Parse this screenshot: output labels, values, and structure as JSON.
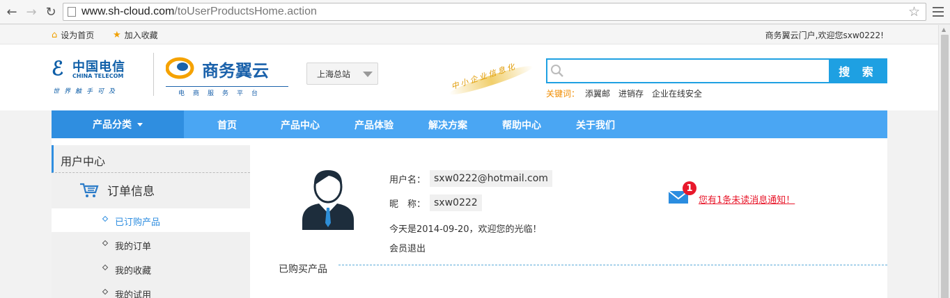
{
  "browser": {
    "url_host": "www.sh-cloud.com",
    "url_path": "/toUserProductsHome.action"
  },
  "topbar": {
    "set_home": "设为首页",
    "add_favorite": "加入收藏",
    "welcome": "商务翼云门户,欢迎您sxw0222!"
  },
  "header": {
    "ct_logo_cn": "中国电信",
    "ct_logo_en": "CHINA TELECOM",
    "ct_slogan": "世界触手可及",
    "sw_logo_cn": "商务翼云",
    "sw_logo_sub": "电商服务平台",
    "station": "上海总站",
    "tagline": "中小企业信息化",
    "search_button": "搜 索",
    "search_placeholder": "",
    "keywords_label": "关键词：",
    "keywords": [
      "添翼邮",
      "进销存",
      "企业在线安全"
    ]
  },
  "nav": {
    "category": "产品分类",
    "items": [
      "首页",
      "产品中心",
      "产品体验",
      "解决方案",
      "帮助中心",
      "关于我们"
    ]
  },
  "sidebar": {
    "title": "用户中心",
    "section": "订单信息",
    "items": [
      "已订购产品",
      "我的订单",
      "我的收藏",
      "我的试用"
    ],
    "active_index": 0
  },
  "profile": {
    "username_label": "用户名：",
    "username": "sxw0222@hotmail.com",
    "nickname_label": "昵　称：",
    "nickname": "sxw0222",
    "greeting": "今天是2014-09-20，欢迎您的光临！",
    "logout": "会员退出",
    "unread_count": "1",
    "unread_message": "您有1条未读消息通知！"
  },
  "purchased_title": "已购买产品",
  "colors": {
    "nav_blue": "#4aa6f3",
    "nav_dark_blue": "#2f8ee0",
    "search_blue": "#1ea0e2",
    "alert_red": "#e8182b",
    "keyword_orange": "#f08c00"
  }
}
